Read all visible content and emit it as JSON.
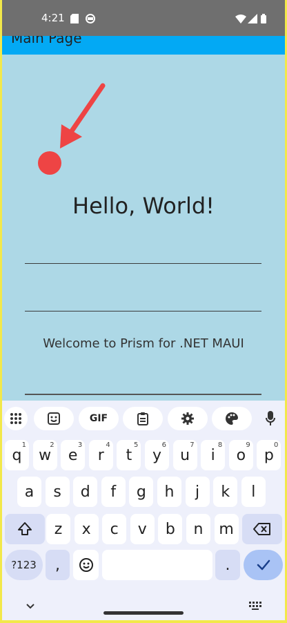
{
  "status": {
    "time": "4:21"
  },
  "appbar": {
    "title": "Main Page"
  },
  "main": {
    "hello": "Hello, World!",
    "welcome": "Welcome to Prism for .NET MAUI"
  },
  "keyboard": {
    "toolbar": {
      "gif": "GIF"
    },
    "row1": [
      {
        "k": "q",
        "s": "1"
      },
      {
        "k": "w",
        "s": "2"
      },
      {
        "k": "e",
        "s": "3"
      },
      {
        "k": "r",
        "s": "4"
      },
      {
        "k": "t",
        "s": "5"
      },
      {
        "k": "y",
        "s": "6"
      },
      {
        "k": "u",
        "s": "7"
      },
      {
        "k": "i",
        "s": "8"
      },
      {
        "k": "o",
        "s": "9"
      },
      {
        "k": "p",
        "s": "0"
      }
    ],
    "row2": [
      "a",
      "s",
      "d",
      "f",
      "g",
      "h",
      "j",
      "k",
      "l"
    ],
    "row3": [
      "z",
      "x",
      "c",
      "v",
      "b",
      "n",
      "m"
    ],
    "bottom": {
      "symbols": "?123",
      "comma": ",",
      "period": "."
    }
  },
  "colors": {
    "page": "#add8e6",
    "appbar": "#03a9f4",
    "statusbar": "#6f6f6f",
    "annotation": "#ee4444"
  }
}
